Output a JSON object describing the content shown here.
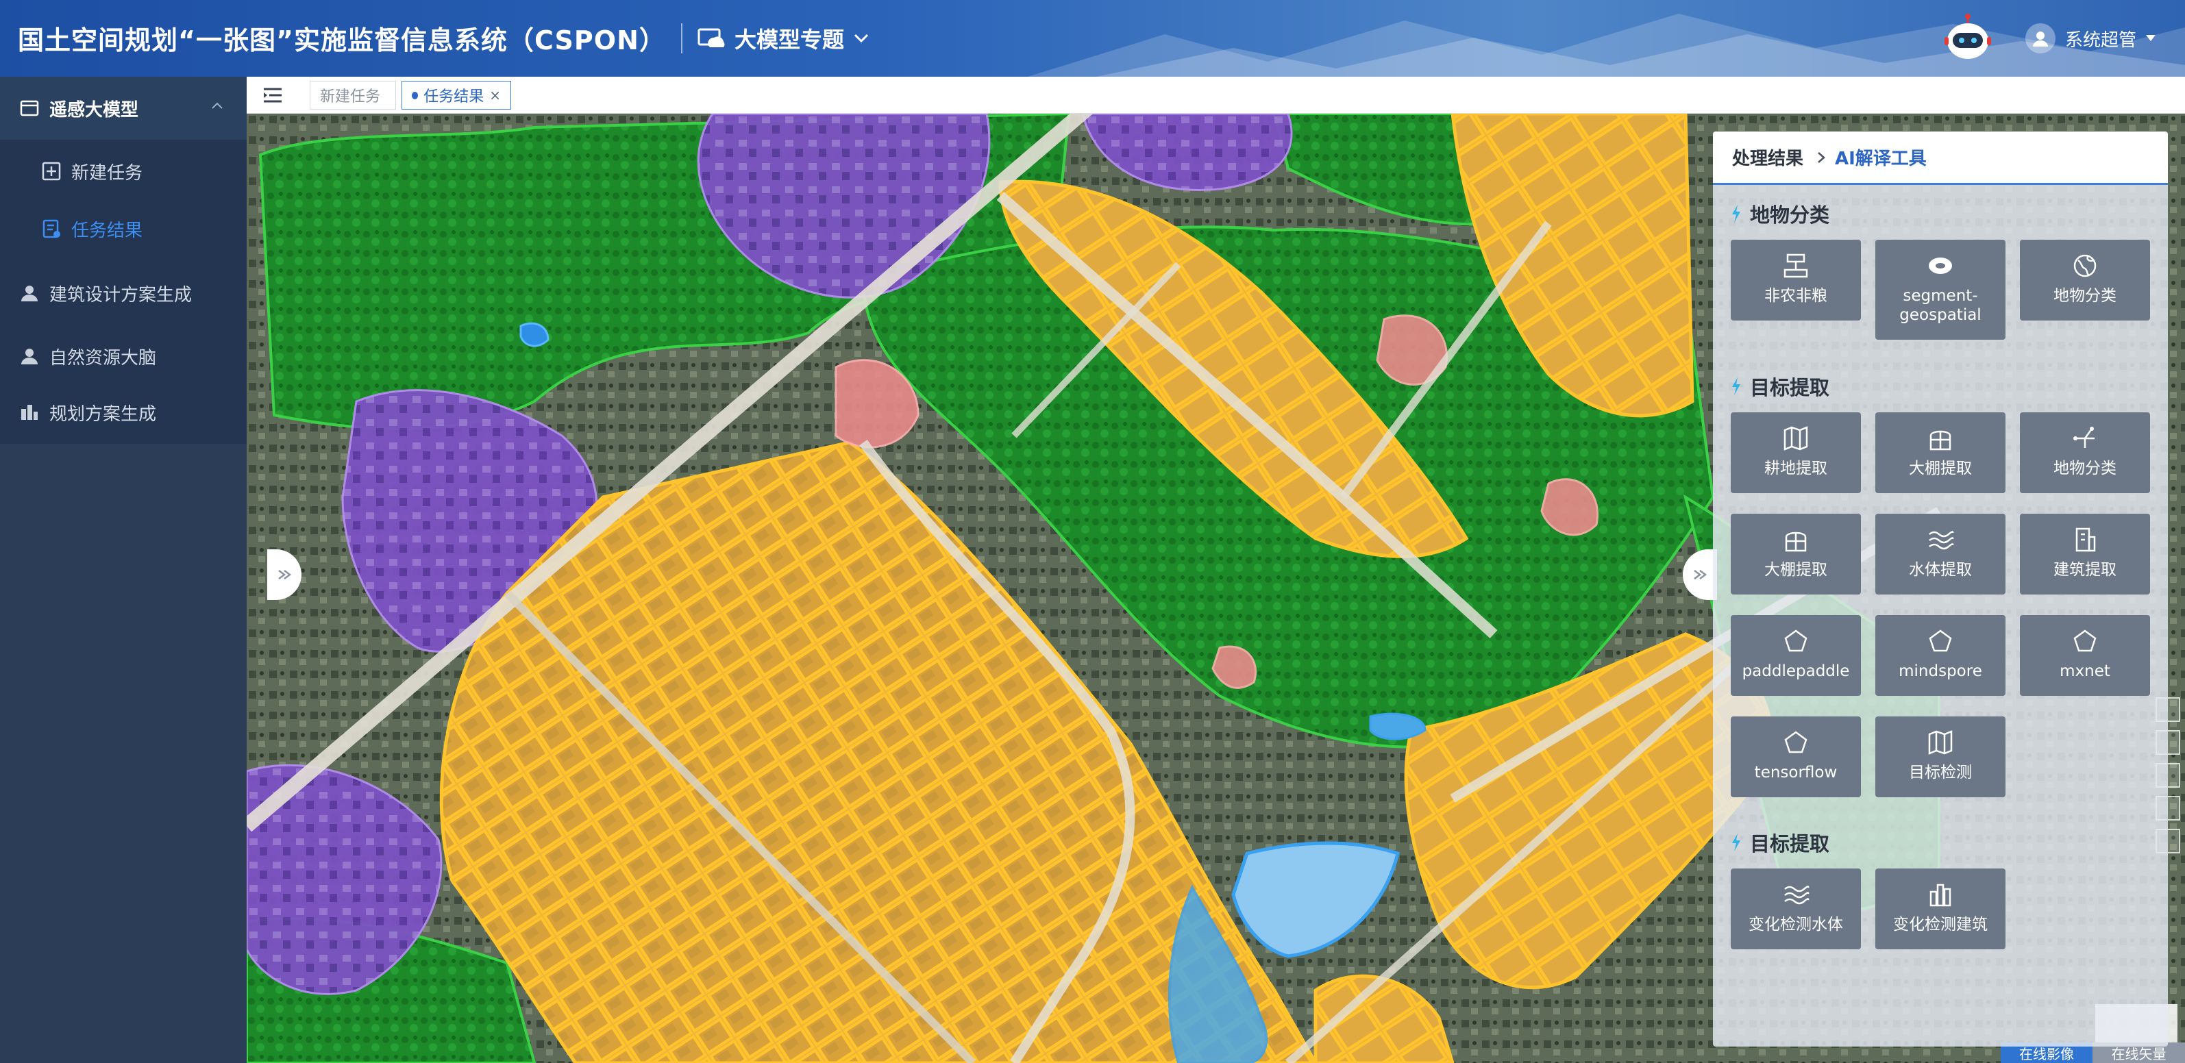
{
  "header": {
    "system_title": "国土空间规划“一张图”实施监督信息系统（CSPON）",
    "topic": "大模型专题",
    "user_name": "系统超管",
    "icons": {
      "topic": "cloud-screen-icon",
      "topic_dropdown": "chevron-down-icon",
      "assistant": "robot-icon",
      "user": "user-avatar-icon",
      "user_dropdown": "caret-down-icon"
    }
  },
  "sidebar": {
    "items": [
      {
        "label": "遥感大模型",
        "icon": "folder-icon",
        "expanded": true
      },
      {
        "label": "新建任务",
        "icon": "plus-square-icon"
      },
      {
        "label": "任务结果",
        "icon": "result-list-icon",
        "active": true
      },
      {
        "label": "建筑设计方案生成",
        "icon": "user-icon"
      },
      {
        "label": "自然资源大脑",
        "icon": "user-icon"
      },
      {
        "label": "规划方案生成",
        "icon": "building-chart-icon"
      }
    ]
  },
  "tabs": [
    {
      "label": "新建任务",
      "active": false
    },
    {
      "label": "任务结果",
      "active": true,
      "closable": true,
      "close_symbol": "×"
    }
  ],
  "panel": {
    "breadcrumb": [
      "处理结果",
      "AI解译工具"
    ],
    "sections": [
      {
        "title": "地物分类",
        "tools": [
          {
            "label": "非农非粮",
            "icon": "field-icon"
          },
          {
            "label": "segment-geospatial",
            "icon": "segment-icon"
          },
          {
            "label": "地物分类",
            "icon": "globe-icon"
          }
        ]
      },
      {
        "title": "目标提取",
        "tools": [
          {
            "label": "耕地提取",
            "icon": "map-fold-icon"
          },
          {
            "label": "大棚提取",
            "icon": "greenhouse-icon"
          },
          {
            "label": "地物分类",
            "icon": "node-network-icon"
          },
          {
            "label": "大棚提取",
            "icon": "greenhouse-icon"
          },
          {
            "label": "水体提取",
            "icon": "water-wave-icon"
          },
          {
            "label": "建筑提取",
            "icon": "building-icon"
          },
          {
            "label": "paddlepaddle",
            "icon": "pentagon-icon"
          },
          {
            "label": "mindspore",
            "icon": "pentagon-icon"
          },
          {
            "label": "mxnet",
            "icon": "pentagon-icon"
          },
          {
            "label": "tensorflow",
            "icon": "pentagon-icon"
          },
          {
            "label": "目标检测",
            "icon": "map-fold-icon"
          }
        ]
      },
      {
        "title": "目标提取",
        "tools": [
          {
            "label": "变化检测水体",
            "icon": "water-wave-icon"
          },
          {
            "label": "变化检测建筑",
            "icon": "building-chart-icon"
          }
        ]
      }
    ]
  },
  "map": {
    "basemap_switch": [
      "在线影像",
      "在线矢量"
    ],
    "active_basemap": "在线影像",
    "layer_colors": {
      "cropland": "#f5b82e",
      "forest": "#1f8a2a",
      "building": "#7b4fc2",
      "water": "#4aa8e8",
      "bare": "#e88a8a"
    }
  },
  "colors": {
    "accent": "#2c66c2",
    "sidebar_bg": "#2c3e57",
    "tile_bg": "#6b7686"
  }
}
